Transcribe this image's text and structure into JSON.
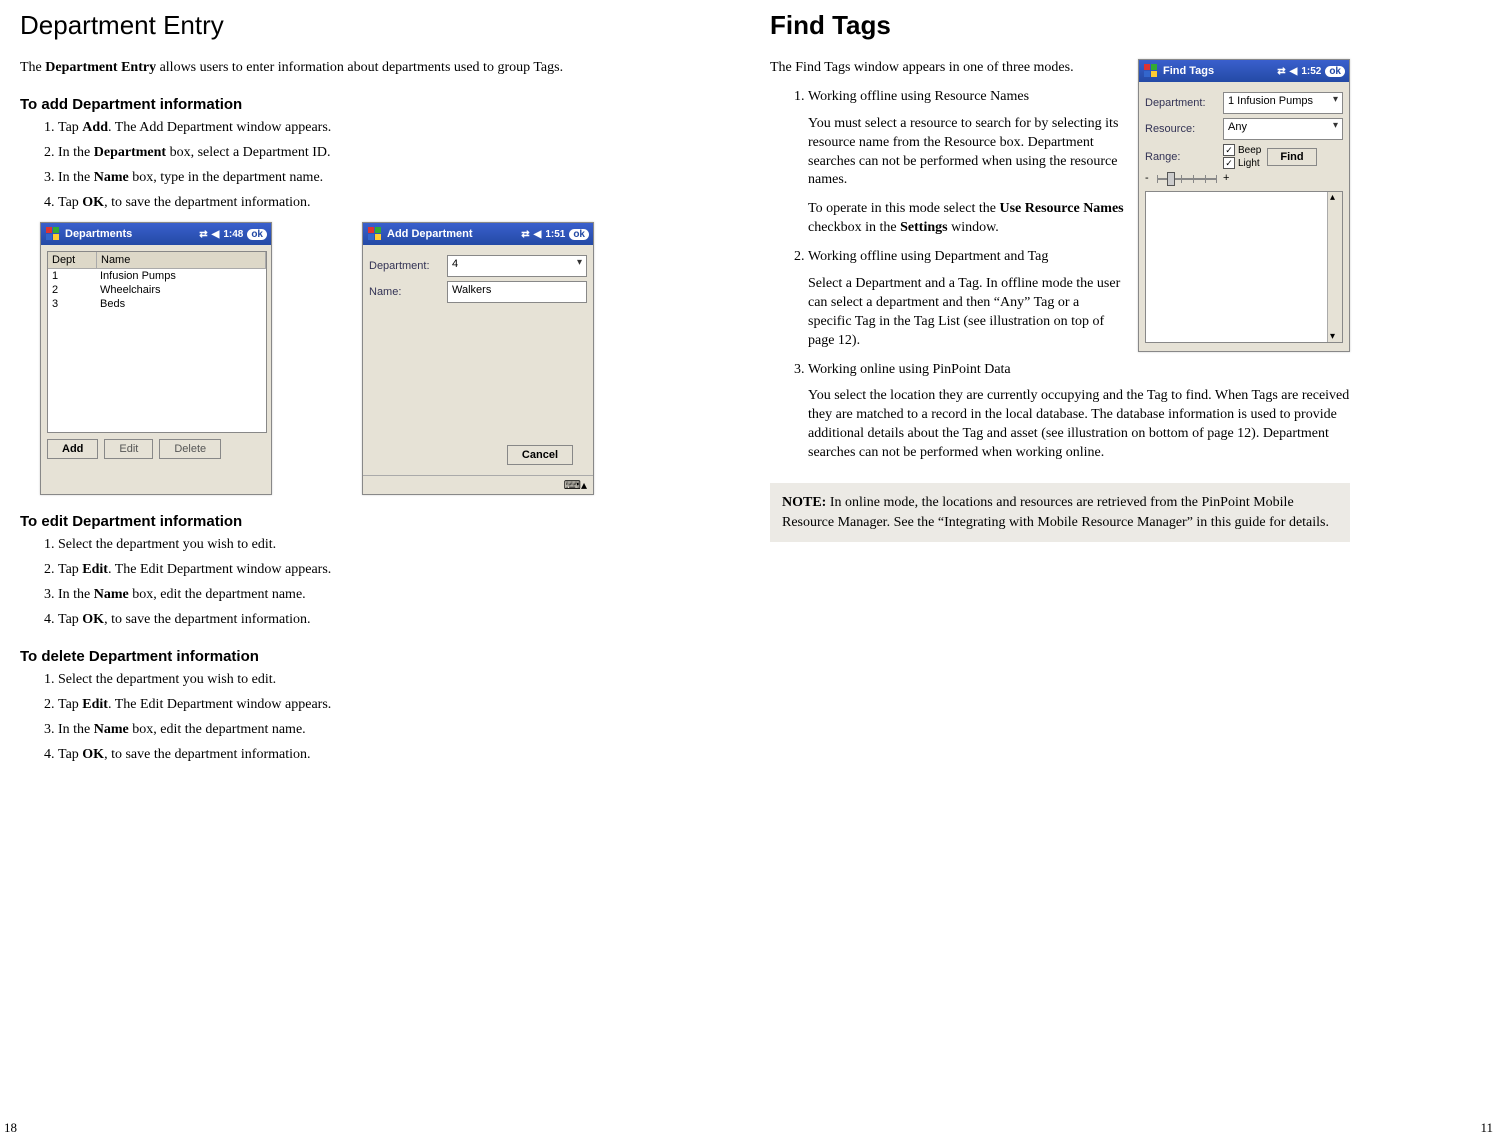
{
  "left": {
    "title": "Department Entry",
    "intro_pre": "The ",
    "intro_bold": "Department Entry",
    "intro_post": " allows users to enter information about departments used to group Tags.",
    "add_heading": "To add Department information",
    "add_steps": {
      "s1_pre": "Tap ",
      "s1_bold": "Add",
      "s1_post": ". The Add Department window appears.",
      "s2_pre": "In the ",
      "s2_bold": "Department",
      "s2_post": " box, select a Department ID.",
      "s3_pre": "In the ",
      "s3_bold": "Name",
      "s3_post": " box, type in the department name.",
      "s4_pre": "Tap ",
      "s4_bold": "OK",
      "s4_post": ", to save the department information."
    },
    "edit_heading": "To edit Department information",
    "edit_steps": {
      "s1": "Select the department you wish to edit.",
      "s2_pre": "Tap ",
      "s2_bold": "Edit",
      "s2_post": ". The Edit Department window appears.",
      "s3_pre": "In the ",
      "s3_bold": "Name",
      "s3_post": " box, edit the department name.",
      "s4_pre": "Tap ",
      "s4_bold": "OK",
      "s4_post": ", to save the department information."
    },
    "delete_heading": "To delete Department information",
    "delete_steps": {
      "s1": "Select the department you wish to edit.",
      "s2_pre": "Tap ",
      "s2_bold": "Edit",
      "s2_post": ". The Edit Department window appears.",
      "s3_pre": "In the ",
      "s3_bold": "Name",
      "s3_post": " box, edit the department name.",
      "s4_pre": "Tap ",
      "s4_bold": "OK",
      "s4_post": ", to save the department information."
    },
    "pda1": {
      "title": "Departments",
      "time": "1:48",
      "ok": "ok",
      "col_dept": "Dept",
      "col_name": "Name",
      "rows": [
        {
          "id": "1",
          "name": "Infusion Pumps"
        },
        {
          "id": "2",
          "name": "Wheelchairs"
        },
        {
          "id": "3",
          "name": "Beds"
        }
      ],
      "btn_add": "Add",
      "btn_edit": "Edit",
      "btn_delete": "Delete"
    },
    "pda2": {
      "title": "Add Department",
      "time": "1:51",
      "ok": "ok",
      "lbl_dept": "Department:",
      "lbl_name": "Name:",
      "val_dept": "4",
      "val_name": "Walkers",
      "btn_cancel": "Cancel"
    },
    "page_num": "18"
  },
  "right": {
    "title": "Find Tags",
    "intro": "The Find Tags window appears in one of three modes.",
    "item1_title": "Working offline using Resource Names",
    "item1_p1": "You must select a resource to search for by selecting its resource name from the Resource box. Department searches can not be performed when using the resource names.",
    "item1_p2_pre": "To operate in this mode select the ",
    "item1_p2_b1": "Use Resource Names",
    "item1_p2_mid": " checkbox in the ",
    "item1_p2_b2": "Settings",
    "item1_p2_post": " window.",
    "item2_title": "Working offline using Department and Tag",
    "item2_p": "Select a Department and a Tag. In offline mode the user can select a department and then “Any” Tag or a specific Tag in the Tag List (see illustration on top of page 12).",
    "item3_title": "Working online using PinPoint Data",
    "item3_p": "You select the location they are currently occupying and the Tag to find. When Tags are received they are matched to a record in the local database. The database information is used to provide additional details about the Tag and asset (see illustration on bottom of page 12). Department searches can not be performed when working online.",
    "note_pre": "NOTE:",
    "note_body": " In online mode, the locations and resources are retrieved from the PinPoint Mobile Resource Manager. See the “Integrating with Mobile Resource Manager” in this guide for details.",
    "pda": {
      "title": "Find Tags",
      "time": "1:52",
      "ok": "ok",
      "lbl_dept": "Department:",
      "lbl_res": "Resource:",
      "lbl_range": "Range:",
      "val_dept": "1 Infusion Pumps",
      "val_res": "Any",
      "chk_beep": "Beep",
      "chk_light": "Light",
      "btn_find": "Find",
      "minus": "-",
      "plus": "+"
    },
    "page_num": "11"
  }
}
